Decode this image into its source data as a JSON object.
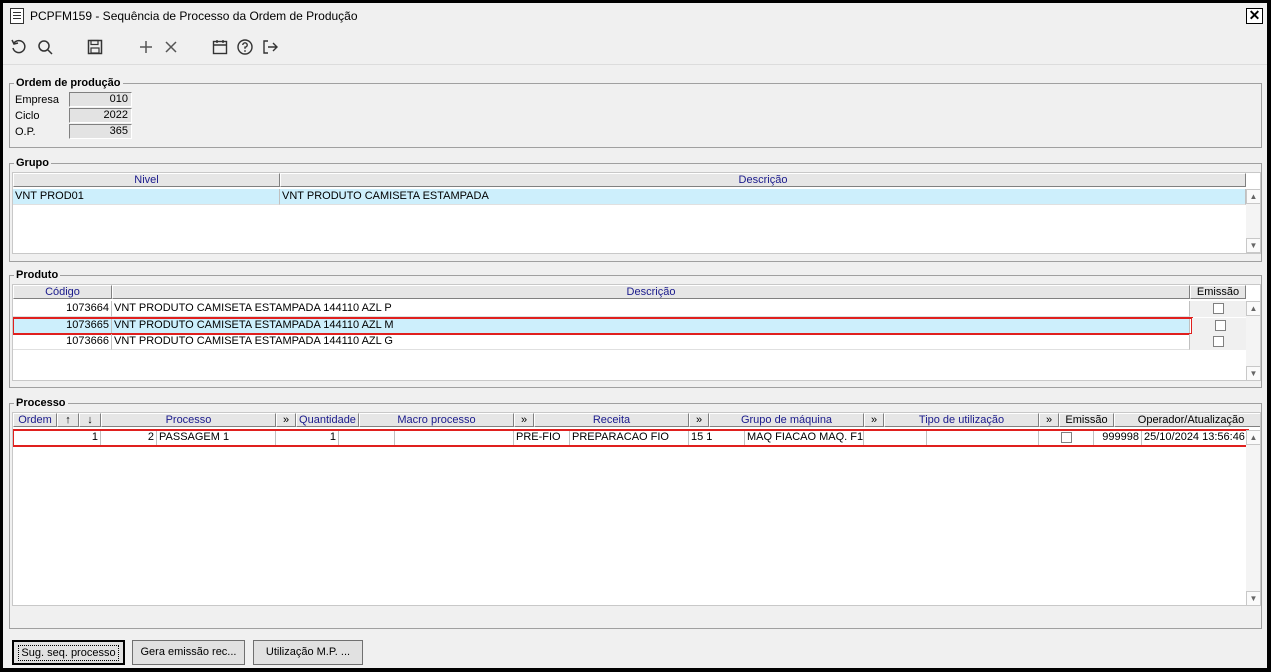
{
  "window": {
    "title": "PCPFM159 - Sequência de Processo da Ordem de Produção",
    "close_label": "✕"
  },
  "toolbar": {
    "icons": [
      "refresh-icon",
      "search-icon",
      "save-icon",
      "add-icon",
      "delete-icon",
      "calendar-icon",
      "help-icon",
      "exit-icon"
    ]
  },
  "ordem": {
    "legend": "Ordem de produção",
    "empresa_label": "Empresa",
    "empresa_value": "010",
    "ciclo_label": "Ciclo",
    "ciclo_value": "2022",
    "op_label": "O.P.",
    "op_value": "365"
  },
  "grupo": {
    "legend": "Grupo",
    "headers": {
      "nivel": "Nivel",
      "descricao": "Descrição"
    },
    "rows": [
      {
        "nivel": "VNT PROD01",
        "descricao": "VNT PRODUTO CAMISETA ESTAMPADA"
      }
    ]
  },
  "produto": {
    "legend": "Produto",
    "headers": {
      "codigo": "Código",
      "descricao": "Descrição",
      "emissao": "Emissão"
    },
    "rows": [
      {
        "codigo": "1073664",
        "descricao": "VNT PRODUTO CAMISETA ESTAMPADA 144110 AZL P"
      },
      {
        "codigo": "1073665",
        "descricao": "VNT PRODUTO CAMISETA ESTAMPADA 144110 AZL M"
      },
      {
        "codigo": "1073666",
        "descricao": "VNT PRODUTO CAMISETA ESTAMPADA 144110 AZL G"
      }
    ]
  },
  "processo": {
    "legend": "Processo",
    "headers": {
      "ordem": "Ordem",
      "up": "↑",
      "down": "↓",
      "processo": "Processo",
      "more": "»",
      "quantidade": "Quantidade",
      "macro": "Macro processo",
      "receita": "Receita",
      "grupo_maquina": "Grupo de máquina",
      "tipo_utilizacao": "Tipo de utilização",
      "emissao": "Emissão",
      "operador": "Operador/Atualização"
    },
    "rows": [
      {
        "ordem": "1",
        "seq": "2",
        "processo": "PASSAGEM 1",
        "quantidade": "1",
        "macro_cod": "",
        "macro_desc": "",
        "receita_cod": "PRE-FIO",
        "receita_desc": "PREPARACAO FIO",
        "grupo_cod": "15 1",
        "grupo_desc": "MAQ FIACAO MAQ. F1",
        "tipo_cod": "",
        "tipo_desc": "",
        "operador": "999998",
        "atualizacao": "25/10/2024 13:56:46"
      }
    ]
  },
  "buttons": {
    "sug": "Sug. seq. processo",
    "gera": "Gera emissão rec...",
    "utilizacao": "Utilização M.P. ..."
  }
}
